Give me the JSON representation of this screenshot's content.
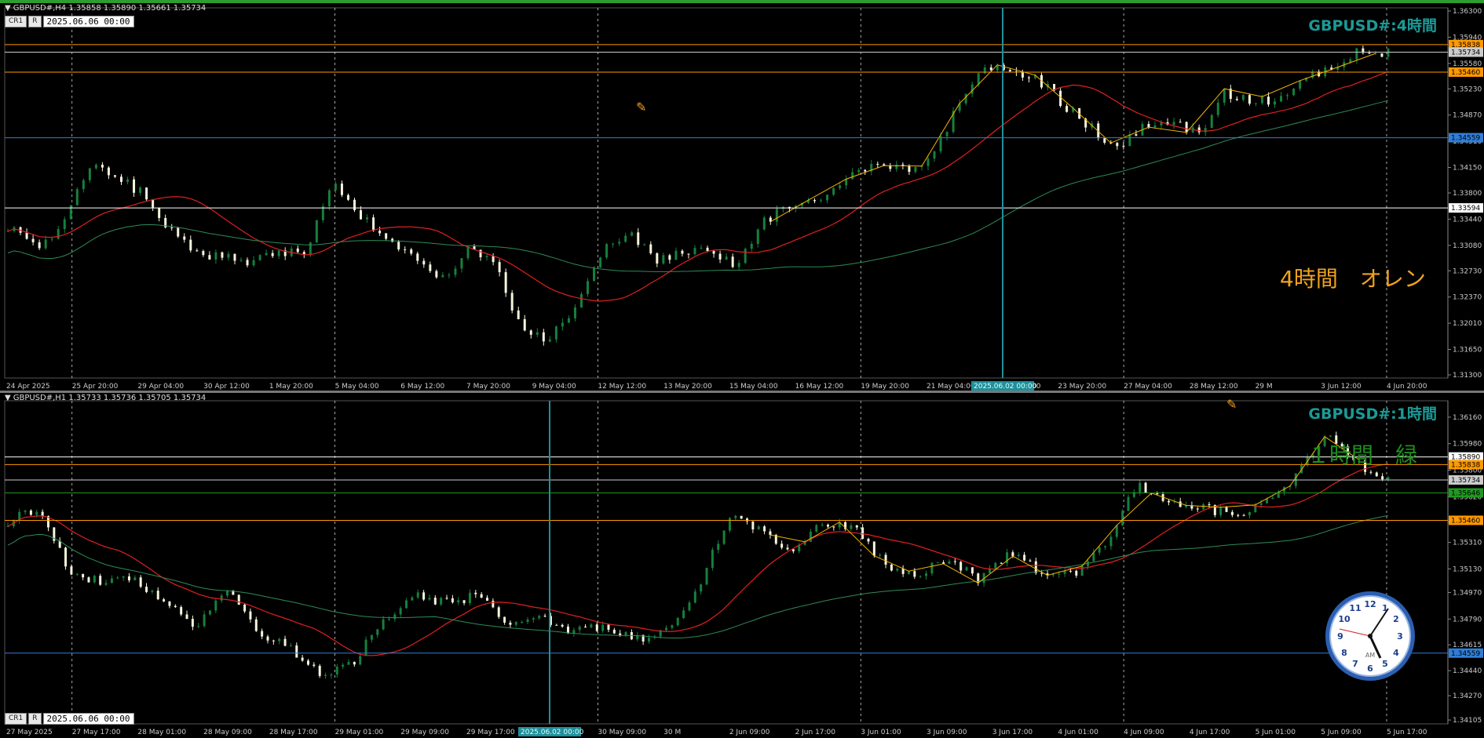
{
  "colors": {
    "background": "#000000",
    "candle_bull": "#15803d",
    "candle_bear": "#f5f5dc",
    "ma_fast": "#e02020",
    "ma_slow": "#2e8b57",
    "zigzag": "#f4b400",
    "grid": "#d0d0d0",
    "price_line_orange": "#ff9900",
    "price_line_white": "#ffffff",
    "price_line_blue": "#2f7fd9",
    "price_line_green": "#1f9a1f",
    "title_teal": "#1a9b97",
    "note_orange": "#f2a31b",
    "note_green": "#1f8f1f"
  },
  "toolbar": {
    "cr_label": "CR1",
    "r_label": "R"
  },
  "panels": [
    {
      "id": "h4",
      "header": "GBPUSD#,H4  1.35858 1.35890 1.35661 1.35734",
      "date_box": "2025.06.06 00:00",
      "big_title": "GBPUSD#:4時間",
      "note": "4時間　オレン",
      "crosshair_label": "2025.06.02 00:00"
    },
    {
      "id": "h1",
      "header": "GBPUSD#,H1  1.35733 1.35736 1.35705 1.35734",
      "date_box": "2025.06.06 00:00",
      "big_title": "GBPUSD#:1時間",
      "note": "１時間　緑",
      "crosshair_label": "2025.06.02 00:00"
    }
  ],
  "chart_data": [
    {
      "type": "candlestick",
      "title": "GBPUSD#:4時間",
      "timeframe": "H4",
      "ylim": [
        1.313,
        1.363
      ],
      "y_ticks": [
        1.363,
        1.3594,
        1.3558,
        1.3523,
        1.3487,
        1.3451,
        1.3415,
        1.338,
        1.3344,
        1.3308,
        1.3273,
        1.3237,
        1.3201,
        1.3165,
        1.313
      ],
      "x_labels": [
        "24 Apr 2025",
        "25 Apr 20:00",
        "29 Apr 04:00",
        "30 Apr 12:00",
        "1 May 20:00",
        "5 May 04:00",
        "6 May 12:00",
        "7 May 20:00",
        "9 May 04:00",
        "12 May 12:00",
        "13 May 20:00",
        "15 May 04:00",
        "16 May 12:00",
        "19 May 20:00",
        "21 May 04:00",
        "22 May 12:00",
        "23 May 20:00",
        "27 May 04:00",
        "28 May 12:00",
        "29 M",
        "3 Jun 12:00",
        "4 Jun 20:00"
      ],
      "price_lines": [
        {
          "value": 1.35838,
          "label": "1.35838",
          "color": "#ff9900"
        },
        {
          "value": 1.35734,
          "label": "1.35734",
          "color": "#cccccc"
        },
        {
          "value": 1.3546,
          "label": "1.35460",
          "color": "#ff9900"
        },
        {
          "value": 1.34559,
          "label": "1.34559",
          "color": "#2f7fd9"
        },
        {
          "value": 1.33594,
          "label": "1.33594",
          "color": "#ffffff"
        }
      ],
      "close_path": [
        [
          "24 Apr 2025",
          1.3335
        ],
        [
          "25 Apr 20:00",
          1.3305
        ],
        [
          "27 Apr",
          1.3335
        ],
        [
          "28 Apr",
          1.342
        ],
        [
          "29 Apr 04:00",
          1.34
        ],
        [
          "30 Apr",
          1.338
        ],
        [
          "30 Apr 12:00",
          1.333
        ],
        [
          "1 May",
          1.33
        ],
        [
          "1 May 20:00",
          1.329
        ],
        [
          "2 May",
          1.3285
        ],
        [
          "5 May 04:00",
          1.33
        ],
        [
          "5 May 20:00",
          1.33
        ],
        [
          "6 May",
          1.3395
        ],
        [
          "6 May 12:00",
          1.335
        ],
        [
          "7 May",
          1.331
        ],
        [
          "7 May 20:00",
          1.329
        ],
        [
          "8 May",
          1.326
        ],
        [
          "9 May 04:00",
          1.33
        ],
        [
          "10 May",
          1.3285
        ],
        [
          "12 May",
          1.319
        ],
        [
          "12 May 12:00",
          1.3175
        ],
        [
          "13 May",
          1.323
        ],
        [
          "13 May 20:00",
          1.33
        ],
        [
          "14 May",
          1.332
        ],
        [
          "15 May 04:00",
          1.329
        ],
        [
          "15 May",
          1.3295
        ],
        [
          "16 May",
          1.33
        ],
        [
          "16 May 12:00",
          1.328
        ],
        [
          "17 May",
          1.3345
        ],
        [
          "19 May 20:00",
          1.336
        ],
        [
          "20 May",
          1.337
        ],
        [
          "21 May 04:00",
          1.34
        ],
        [
          "21 May",
          1.342
        ],
        [
          "22 May",
          1.341
        ],
        [
          "22 May 12:00",
          1.342
        ],
        [
          "23 May",
          1.349
        ],
        [
          "23 May 20:00",
          1.356
        ],
        [
          "26 May",
          1.3545
        ],
        [
          "27 May 04:00",
          1.354
        ],
        [
          "27 May",
          1.35
        ],
        [
          "28 May",
          1.347
        ],
        [
          "28 May 12:00",
          1.344
        ],
        [
          "29 May",
          1.347
        ],
        [
          "30 May",
          1.348
        ],
        [
          "2 Jun",
          1.346
        ],
        [
          "2 Jun 12:00",
          1.352
        ],
        [
          "3 Jun",
          1.35
        ],
        [
          "3 Jun 12:00",
          1.3515
        ],
        [
          "4 Jun",
          1.354
        ],
        [
          "4 Jun 20:00",
          1.3555
        ],
        [
          "5 Jun",
          1.3575
        ],
        [
          "6 Jun",
          1.3573
        ]
      ],
      "moving_averages": [
        {
          "name": "MA fast",
          "color": "#e02020"
        },
        {
          "name": "MA slow",
          "color": "#2e8b57"
        }
      ],
      "zigzag_color": "#f4b400",
      "grid": true
    },
    {
      "type": "candlestick",
      "title": "GBPUSD#:1時間",
      "timeframe": "H1",
      "ylim": [
        1.341,
        1.3625
      ],
      "y_ticks": [
        1.3616,
        1.3598,
        1.358,
        1.3562,
        1.3545,
        1.3531,
        1.3513,
        1.3497,
        1.3479,
        1.34615,
        1.3444,
        1.3427,
        1.34105
      ],
      "x_labels": [
        "27 May 2025",
        "27 May 17:00",
        "28 May 01:00",
        "28 May 09:00",
        "28 May 17:00",
        "29 May 01:00",
        "29 May 09:00",
        "29 May 17:00",
        "30 May 01:00",
        "30 May 09:00",
        "30 M",
        "2 Jun 09:00",
        "2 Jun 17:00",
        "3 Jun 01:00",
        "3 Jun 09:00",
        "3 Jun 17:00",
        "4 Jun 01:00",
        "4 Jun 09:00",
        "4 Jun 17:00",
        "5 Jun 01:00",
        "5 Jun 09:00",
        "5 Jun 17:00"
      ],
      "price_lines": [
        {
          "value": 1.3589,
          "label": "1.35890",
          "color": "#ffffff"
        },
        {
          "value": 1.35838,
          "label": "1.35838",
          "color": "#ff9900"
        },
        {
          "value": 1.35734,
          "label": "1.35734",
          "color": "#cccccc"
        },
        {
          "value": 1.35646,
          "label": "1.35646",
          "color": "#1f9a1f"
        },
        {
          "value": 1.3546,
          "label": "1.35460",
          "color": "#ff9900"
        },
        {
          "value": 1.34559,
          "label": "1.34559",
          "color": "#2f7fd9"
        }
      ],
      "close_path": [
        [
          "27 May 2025",
          1.3545
        ],
        [
          "27 May 08:00",
          1.3555
        ],
        [
          "27 May 12:00",
          1.351
        ],
        [
          "27 May 17:00",
          1.3505
        ],
        [
          "28 May 01:00",
          1.3505
        ],
        [
          "28 May 05:00",
          1.349
        ],
        [
          "28 May 09:00",
          1.3475
        ],
        [
          "28 May 13:00",
          1.35
        ],
        [
          "28 May 17:00",
          1.347
        ],
        [
          "28 May 21:00",
          1.346
        ],
        [
          "29 May 01:00",
          1.344
        ],
        [
          "29 May 05:00",
          1.345
        ],
        [
          "29 May 09:00",
          1.348
        ],
        [
          "29 May 13:00",
          1.3495
        ],
        [
          "29 May 17:00",
          1.349
        ],
        [
          "29 May 21:00",
          1.3495
        ],
        [
          "30 May 01:00",
          1.3475
        ],
        [
          "30 May 05:00",
          1.348
        ],
        [
          "30 May 09:00",
          1.347
        ],
        [
          "30 May 13:00",
          1.3475
        ],
        [
          "30 May 17:00",
          1.3465
        ],
        [
          "2 Jun 01:00",
          1.347
        ],
        [
          "2 Jun 05:00",
          1.35
        ],
        [
          "2 Jun 09:00",
          1.355
        ],
        [
          "2 Jun 13:00",
          1.354
        ],
        [
          "2 Jun 17:00",
          1.3525
        ],
        [
          "2 Jun 21:00",
          1.3545
        ],
        [
          "3 Jun 01:00",
          1.354
        ],
        [
          "3 Jun 05:00",
          1.3515
        ],
        [
          "3 Jun 09:00",
          1.351
        ],
        [
          "3 Jun 13:00",
          1.352
        ],
        [
          "3 Jun 17:00",
          1.3505
        ],
        [
          "3 Jun 21:00",
          1.3525
        ],
        [
          "4 Jun 01:00",
          1.351
        ],
        [
          "4 Jun 05:00",
          1.351
        ],
        [
          "4 Jun 09:00",
          1.353
        ],
        [
          "4 Jun 13:00",
          1.357
        ],
        [
          "4 Jun 17:00",
          1.356
        ],
        [
          "4 Jun 21:00",
          1.3555
        ],
        [
          "5 Jun 01:00",
          1.355
        ],
        [
          "5 Jun 05:00",
          1.3555
        ],
        [
          "5 Jun 09:00",
          1.3575
        ],
        [
          "5 Jun 13:00",
          1.3605
        ],
        [
          "5 Jun 17:00",
          1.3585
        ],
        [
          "5 Jun 21:00",
          1.3573
        ]
      ],
      "moving_averages": [
        {
          "name": "MA fast",
          "color": "#e02020"
        },
        {
          "name": "MA slow",
          "color": "#2e8b57"
        }
      ],
      "zigzag_color": "#f4b400",
      "grid": true
    }
  ]
}
